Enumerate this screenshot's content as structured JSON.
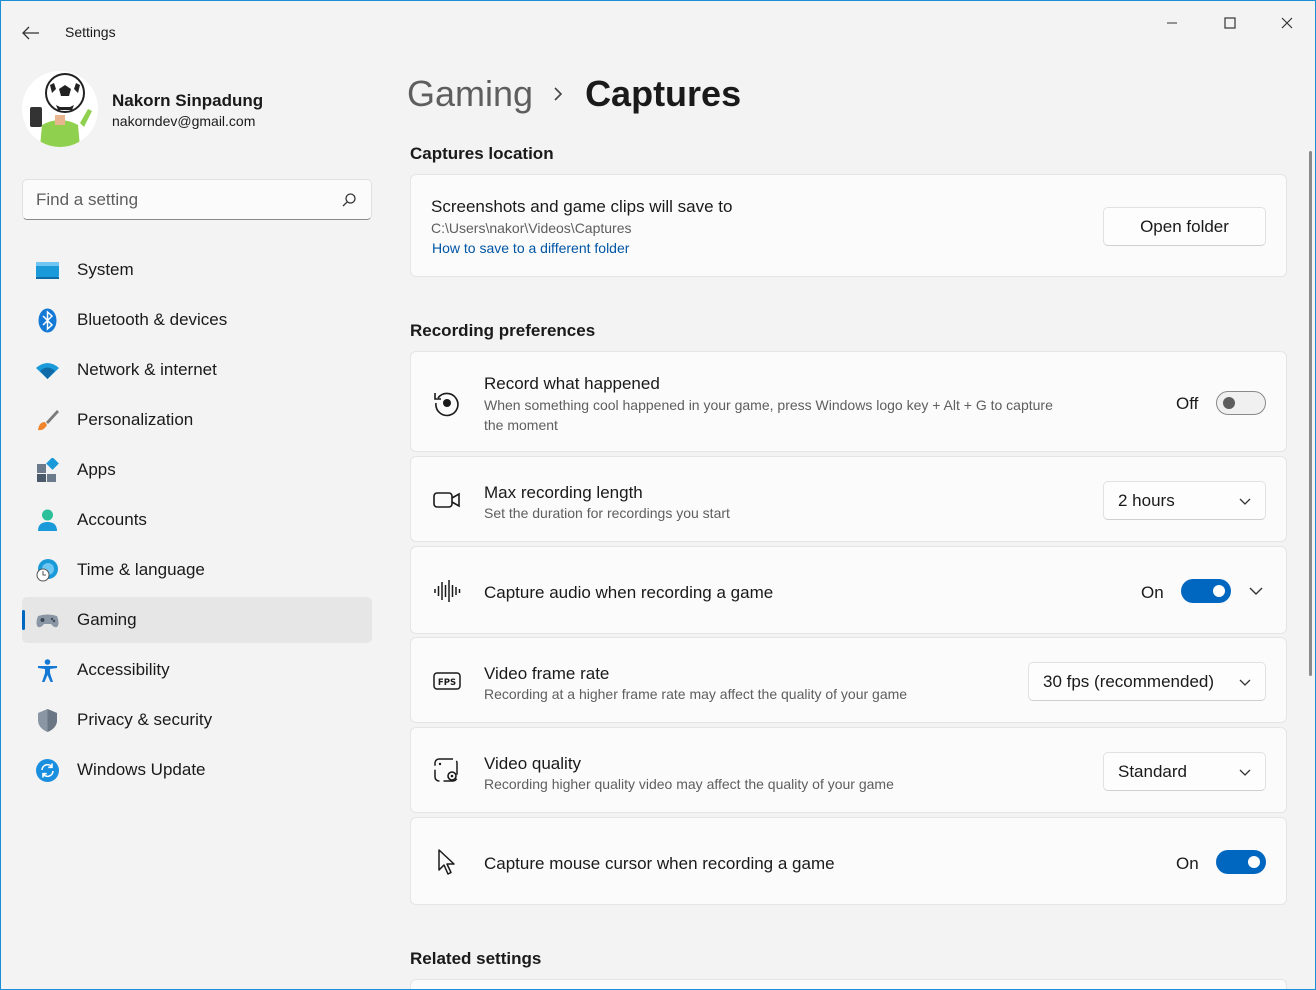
{
  "window": {
    "title": "Settings"
  },
  "profile": {
    "name": "Nakorn Sinpadung",
    "email": "nakorndev@gmail.com"
  },
  "search": {
    "placeholder": "Find a setting"
  },
  "sidebar": {
    "items": [
      {
        "label": "System",
        "icon": "system-icon"
      },
      {
        "label": "Bluetooth & devices",
        "icon": "bluetooth-icon"
      },
      {
        "label": "Network & internet",
        "icon": "wifi-icon"
      },
      {
        "label": "Personalization",
        "icon": "brush-icon"
      },
      {
        "label": "Apps",
        "icon": "apps-icon"
      },
      {
        "label": "Accounts",
        "icon": "accounts-icon"
      },
      {
        "label": "Time & language",
        "icon": "time-language-icon"
      },
      {
        "label": "Gaming",
        "icon": "gamepad-icon",
        "active": true
      },
      {
        "label": "Accessibility",
        "icon": "accessibility-icon"
      },
      {
        "label": "Privacy & security",
        "icon": "shield-icon"
      },
      {
        "label": "Windows Update",
        "icon": "update-icon"
      }
    ]
  },
  "breadcrumb": {
    "parent": "Gaming",
    "current": "Captures"
  },
  "captures_location": {
    "section_title": "Captures location",
    "title": "Screenshots and game clips will save to",
    "path": "C:\\Users\\nakor\\Videos\\Captures",
    "link": "How to save to a different folder",
    "button": "Open folder"
  },
  "recording": {
    "section_title": "Recording preferences",
    "record_what_happened": {
      "title": "Record what happened",
      "desc": "When something cool happened in your game, press Windows logo key + Alt + G to capture the moment",
      "state": "Off"
    },
    "max_length": {
      "title": "Max recording length",
      "desc": "Set the duration for recordings you start",
      "value": "2 hours"
    },
    "capture_audio": {
      "title": "Capture audio when recording a game",
      "state": "On"
    },
    "frame_rate": {
      "title": "Video frame rate",
      "desc": "Recording at a higher frame rate may affect the quality of your game",
      "value": "30 fps (recommended)"
    },
    "quality": {
      "title": "Video quality",
      "desc": "Recording higher quality video may affect the quality of your game",
      "value": "Standard"
    },
    "mouse_cursor": {
      "title": "Capture mouse cursor when recording a game",
      "state": "On"
    }
  },
  "related": {
    "section_title": "Related settings"
  },
  "colors": {
    "accent": "#0067c0",
    "background": "#f3f3f3",
    "card": "#fbfbfb"
  }
}
